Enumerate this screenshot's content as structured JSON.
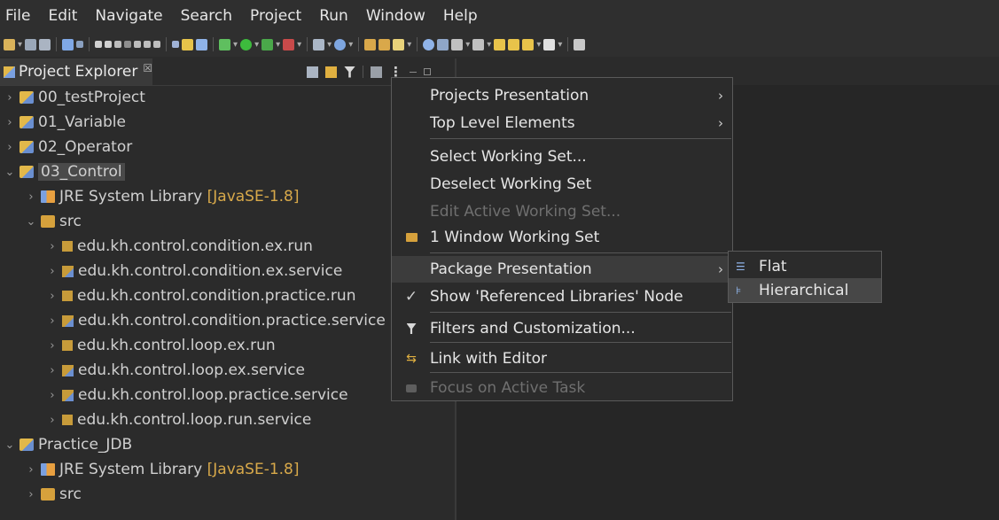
{
  "menubar": [
    "File",
    "Edit",
    "Navigate",
    "Search",
    "Project",
    "Run",
    "Window",
    "Help"
  ],
  "view": {
    "title": "Project Explorer",
    "close": "☒"
  },
  "tree": [
    {
      "label": "00_testProject"
    },
    {
      "label": "01_Variable"
    },
    {
      "label": "02_Operator"
    },
    {
      "label": "03_Control"
    },
    {
      "label": "JRE System Library",
      "decoration": "[JavaSE-1.8]"
    },
    {
      "label": "src"
    },
    {
      "label": "edu.kh.control.condition.ex.run"
    },
    {
      "label": "edu.kh.control.condition.ex.service"
    },
    {
      "label": "edu.kh.control.condition.practice.run"
    },
    {
      "label": "edu.kh.control.condition.practice.service"
    },
    {
      "label": "edu.kh.control.loop.ex.run"
    },
    {
      "label": "edu.kh.control.loop.ex.service"
    },
    {
      "label": "edu.kh.control.loop.practice.service"
    },
    {
      "label": "edu.kh.control.loop.run.service"
    },
    {
      "label": "Practice_JDB"
    },
    {
      "label": "JRE System Library",
      "decoration": "[JavaSE-1.8]"
    },
    {
      "label": "src"
    }
  ],
  "context_menu": {
    "projects_presentation": "Projects Presentation",
    "top_level_elements": "Top Level Elements",
    "select_working_set": "Select Working Set...",
    "deselect_working_set": "Deselect Working Set",
    "edit_active_working_set": "Edit Active Working Set...",
    "window_working_set": "1 Window Working Set",
    "package_presentation": "Package Presentation",
    "show_referenced_libraries": "Show 'Referenced Libraries' Node",
    "filters_and_customization": "Filters and Customization...",
    "link_with_editor": "Link with Editor",
    "focus_on_active_task": "Focus on Active Task",
    "submenu_arrow": "›"
  },
  "package_presentation_submenu": {
    "flat": "Flat",
    "hierarchical": "Hierarchical"
  }
}
